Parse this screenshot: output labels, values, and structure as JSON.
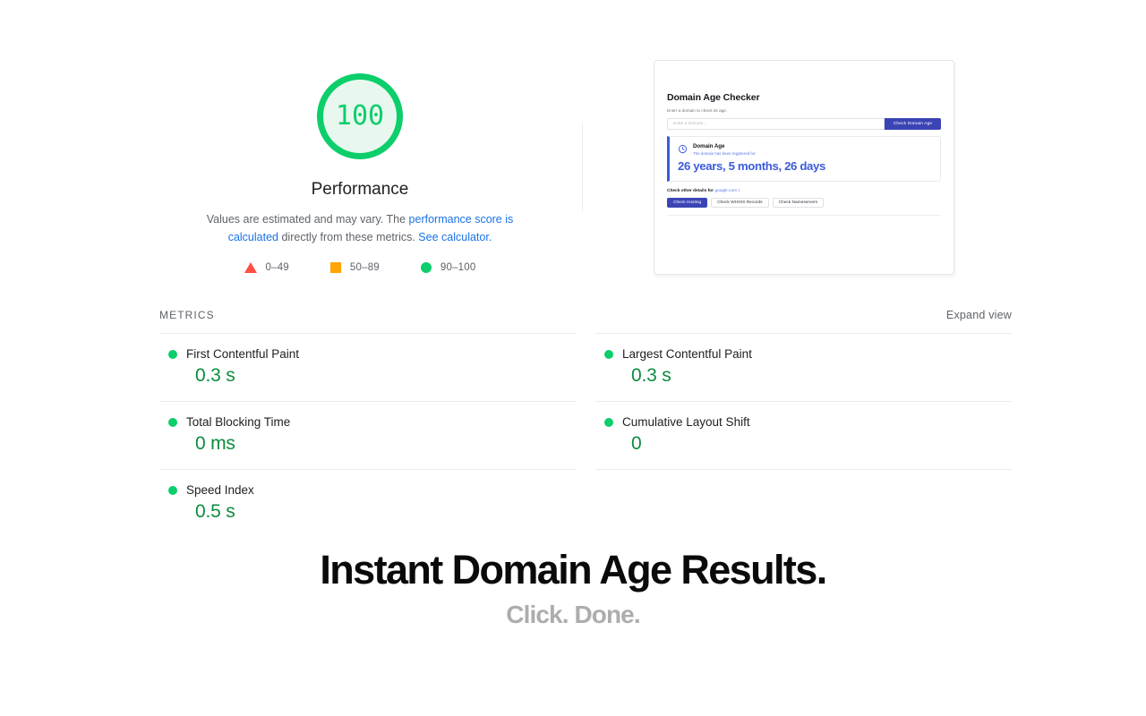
{
  "report": {
    "score": {
      "value": "100",
      "label": "Performance",
      "ring_color": "#0CCE6B",
      "fill_color": "#e8f8ef",
      "text_color": "#0CCE6B",
      "percent": 100
    },
    "description": {
      "prefix": "Values are estimated and may vary. The ",
      "link1": "performance score is calculated",
      "middle": " directly from these metrics. ",
      "link2": "See calculator.",
      "link_color": "#1a73e8"
    },
    "legend": [
      {
        "icon": "triangle-icon",
        "range": "0–49",
        "color": "#FF4E42"
      },
      {
        "icon": "square-icon",
        "range": "50–89",
        "color": "#FFA400"
      },
      {
        "icon": "circle-icon",
        "range": "90–100",
        "color": "#0CCE6B"
      }
    ]
  },
  "screenshot_preview": {
    "title": "Domain Age Checker",
    "subtitle": "Enter a domain to check its age.",
    "input_placeholder": "Enter a Domain...",
    "submit_label": "Check Domain Age",
    "submit_color": "#3b44b5",
    "result": {
      "icon": "clock-icon",
      "title": "Domain Age",
      "subtitle": "The domain has been registered for:",
      "value": "26 years, 5 months, 26 days",
      "value_color": "#3b5bdb"
    },
    "other_details": {
      "prefix": "Check other details for ",
      "domain": "google.com",
      "suffix": " :"
    },
    "pills": [
      {
        "label": "Check Hosting",
        "active": true
      },
      {
        "label": "Check WHOIS Records",
        "active": false
      },
      {
        "label": "Check Nameservers",
        "active": false
      }
    ]
  },
  "metrics": {
    "section_title": "METRICS",
    "expand_label": "Expand view",
    "left": [
      {
        "name": "First Contentful Paint",
        "value": "0.3 s",
        "status": "pass",
        "status_color": "#0CCE6B"
      },
      {
        "name": "Total Blocking Time",
        "value": "0 ms",
        "status": "pass",
        "status_color": "#0CCE6B"
      },
      {
        "name": "Speed Index",
        "value": "0.5 s",
        "status": "pass",
        "status_color": "#0CCE6B"
      }
    ],
    "right": [
      {
        "name": "Largest Contentful Paint",
        "value": "0.3 s",
        "status": "pass",
        "status_color": "#0CCE6B"
      },
      {
        "name": "Cumulative Layout Shift",
        "value": "0",
        "status": "pass",
        "status_color": "#0CCE6B"
      }
    ]
  },
  "hero": {
    "title": "Instant Domain Age Results.",
    "subtitle": "Click. Done."
  }
}
